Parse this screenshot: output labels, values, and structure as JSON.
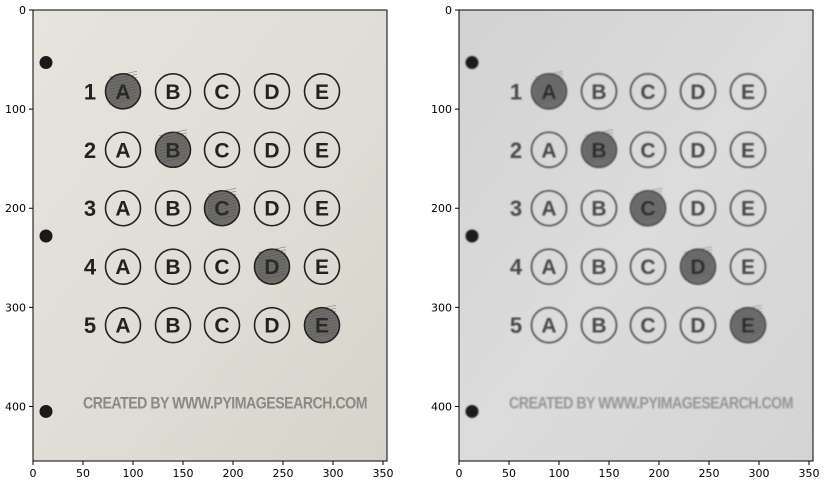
{
  "panels": [
    {
      "name": "original",
      "paper_color": "#e1dfd8",
      "ink_color": "#222222",
      "fill_color": "#6f6d69",
      "credit_color": "#8a8985",
      "hole_color": "#1a1a1a"
    },
    {
      "name": "grayscale-blurred",
      "paper_color": "#d9d9d9",
      "ink_color": "#4a4a4a",
      "fill_color": "#6e6e6e",
      "credit_color": "#969696",
      "hole_color": "#1c1c1c"
    }
  ],
  "axes": {
    "x_ticks": [
      "0",
      "50",
      "100",
      "150",
      "200",
      "250",
      "300",
      "350"
    ],
    "y_ticks": [
      "0",
      "100",
      "200",
      "300",
      "400"
    ]
  },
  "sheet": {
    "options": [
      "A",
      "B",
      "C",
      "D",
      "E"
    ],
    "questions": [
      {
        "number": "1",
        "filled": "A"
      },
      {
        "number": "2",
        "filled": "B"
      },
      {
        "number": "3",
        "filled": "C"
      },
      {
        "number": "4",
        "filled": "D"
      },
      {
        "number": "5",
        "filled": "E"
      }
    ],
    "credit": "CREATED BY WWW.PYIMAGESEARCH.COM"
  }
}
